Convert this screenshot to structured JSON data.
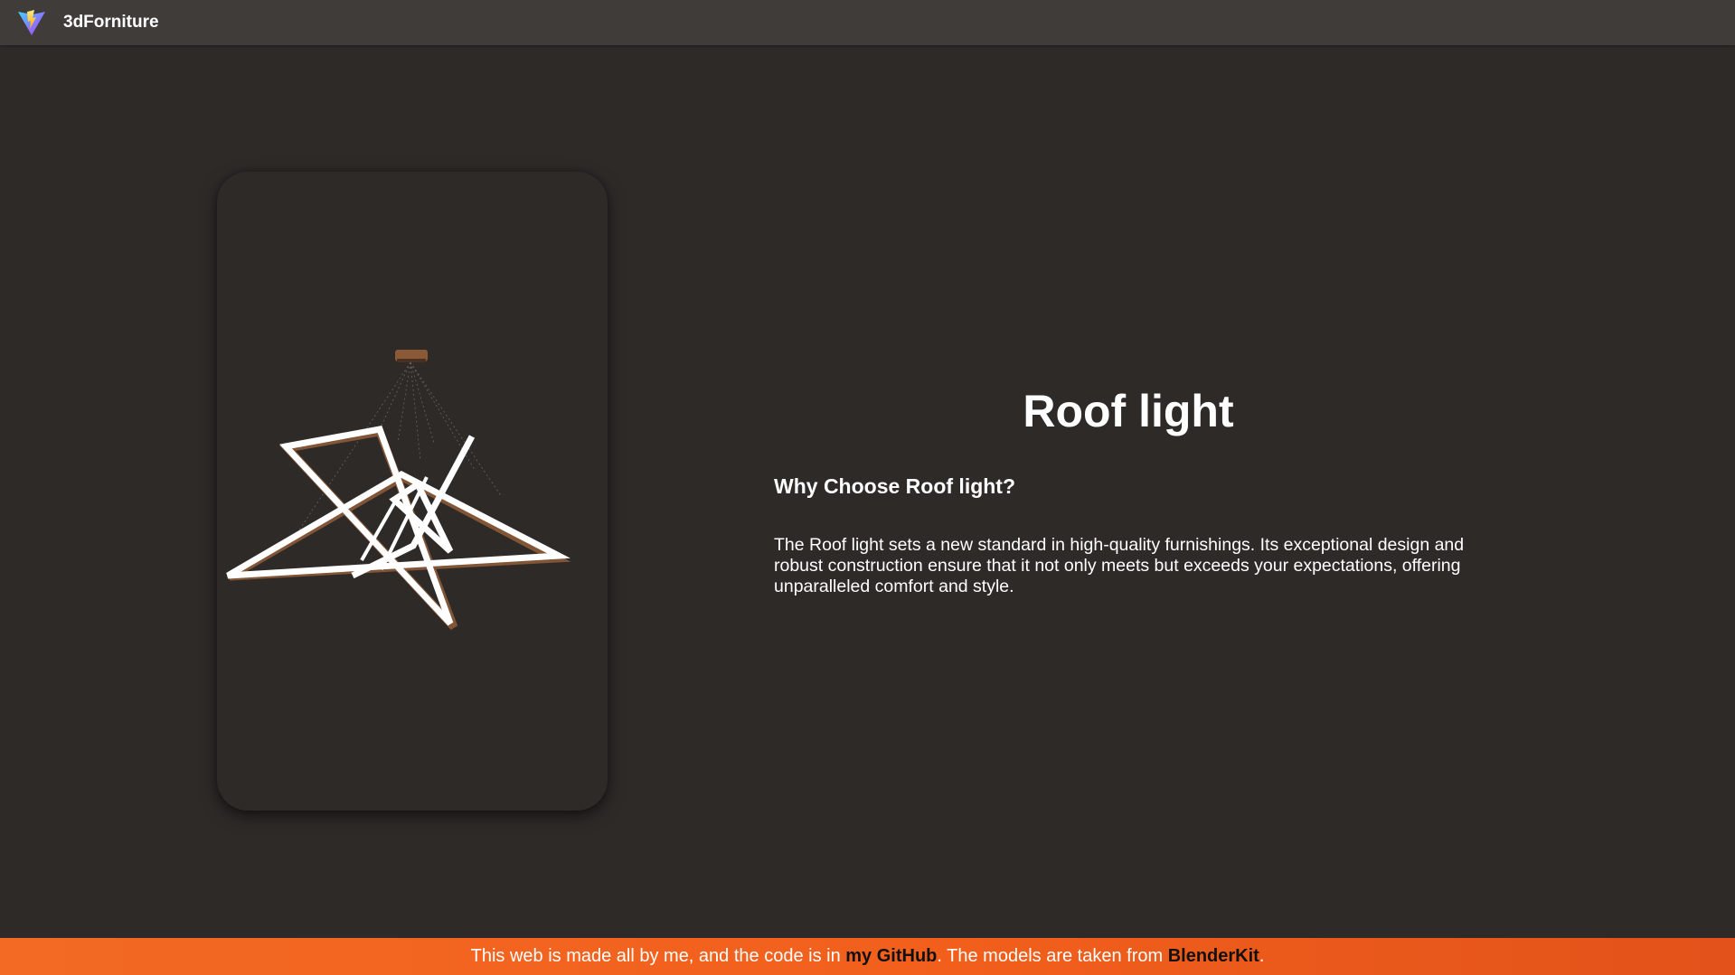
{
  "header": {
    "logo_icon": "vite-logo-icon",
    "brand": "3dForniture",
    "background": "#403c3a"
  },
  "viewer": {
    "model": "roof-light-chandelier-model"
  },
  "product": {
    "title": "Roof light",
    "subtitle": "Why Choose Roof light?",
    "description": "The Roof light sets a new standard in high-quality furnishings. Its exceptional design and robust construction ensure that it not only meets but exceeds your expectations, offering unparalleled comfort and style."
  },
  "footer": {
    "text_before": "This web is made all by me, and the code is in ",
    "github_link": "my GitHub",
    "text_middle": ". The models are taken from ",
    "blenderkit_link": "BlenderKit",
    "text_after": ".",
    "accent": "#f26522"
  },
  "colors": {
    "page_background": "#2e2a28",
    "text": "#ffffff",
    "link": "#111111"
  }
}
